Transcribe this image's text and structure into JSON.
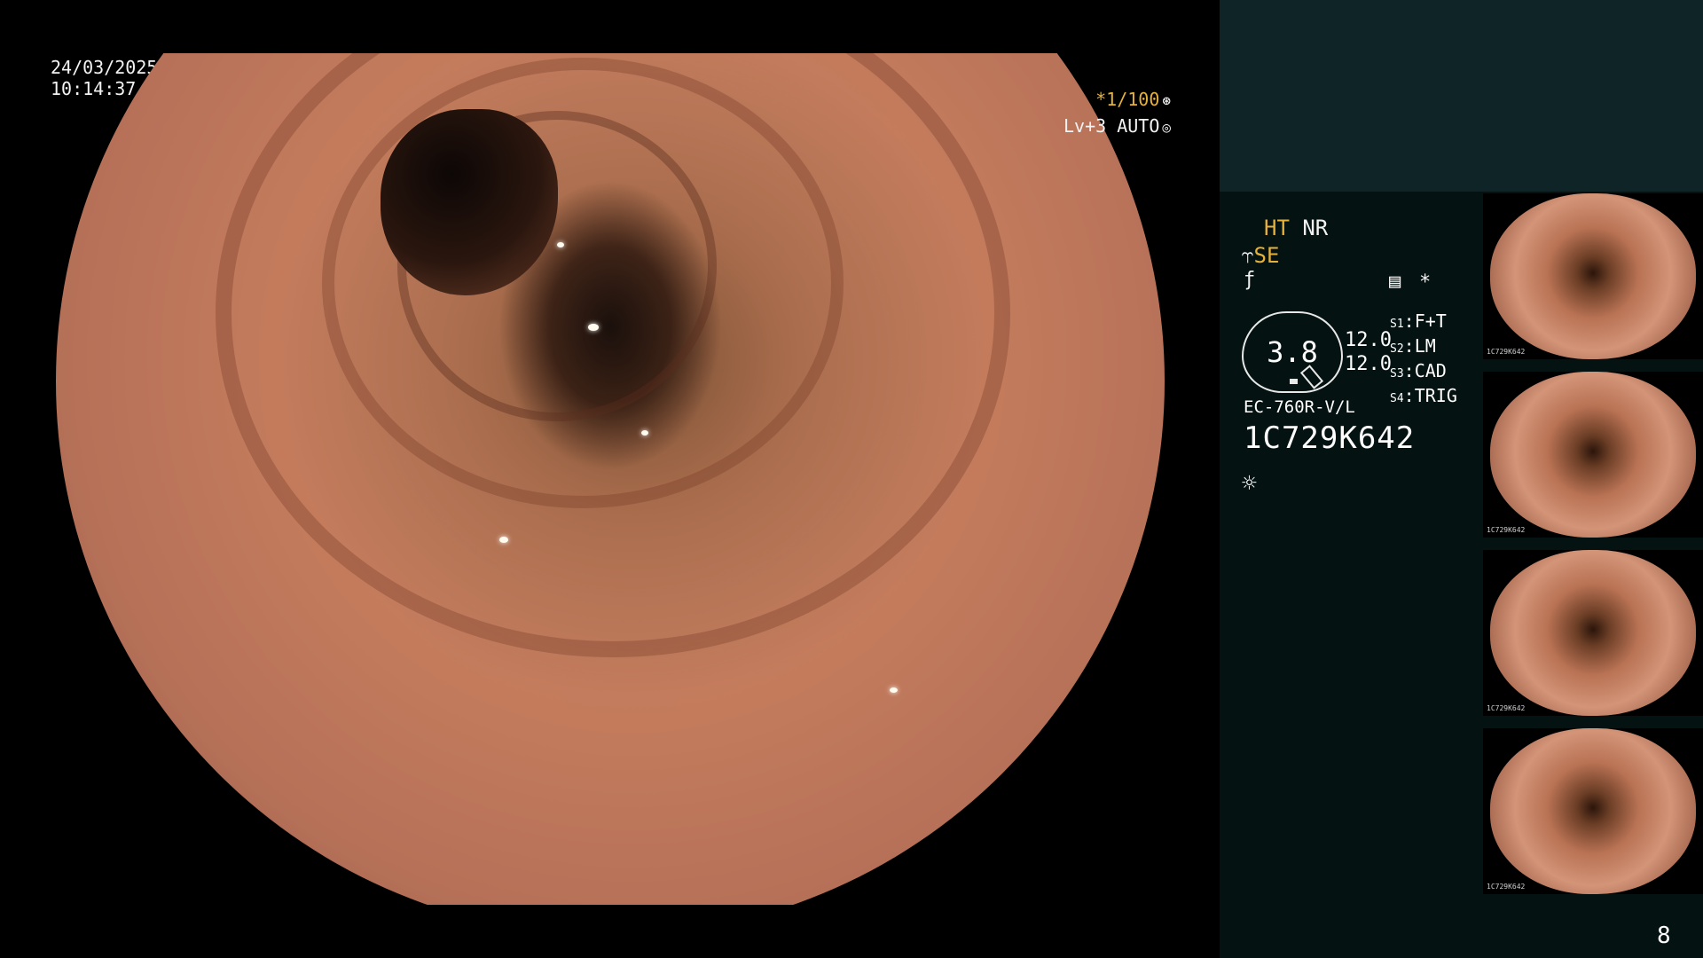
{
  "screen": {
    "date": "24/03/2025",
    "time": "10:14:37",
    "page_number": "8"
  },
  "exposure": {
    "shutter": "*1/100",
    "shutter_icon": "aperture-icon",
    "level": "Lv+3 AUTO",
    "level_icon": "auto-iris-icon"
  },
  "status": {
    "ht": "HT",
    "nr": "NR",
    "se": "SE",
    "se_icon": "water-jet-icon",
    "freeze_icon": "freeze-off-icon",
    "memory_icon": "memory-card-icon",
    "asterisk": "*",
    "circle_value": "3.8",
    "value_a": "12.0",
    "value_b": "12.0",
    "scope_model": "EC-760R-V/L",
    "scope_serial": "1C729K642",
    "light_icon": "light-source-icon"
  },
  "slots": [
    {
      "key": "S1",
      "value": "F+T"
    },
    {
      "key": "S2",
      "value": "LM"
    },
    {
      "key": "S3",
      "value": "CAD"
    },
    {
      "key": "S4",
      "value": "TRIG"
    }
  ],
  "thumbnails": [
    {
      "caption": "1C729K642"
    },
    {
      "caption": "1C729K642"
    },
    {
      "caption": "1C729K642"
    },
    {
      "caption": "1C729K642"
    }
  ],
  "colors": {
    "accent_orange": "#e5b13a",
    "panel_dark": "#041212",
    "panel_top": "#0e2426"
  }
}
